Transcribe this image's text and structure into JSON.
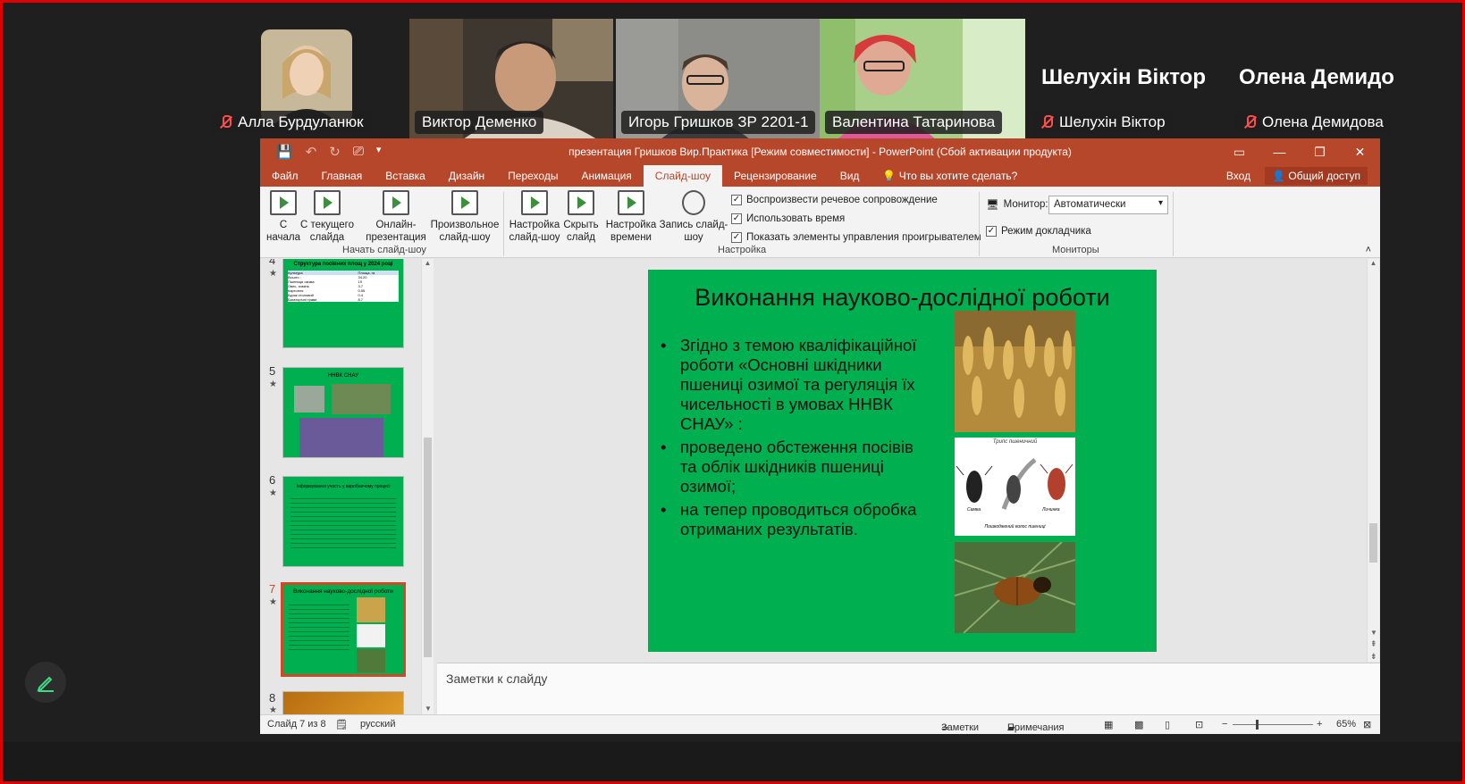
{
  "participants": [
    {
      "name": "Алла Бурдуланюк",
      "muted": true
    },
    {
      "name": "Виктор Деменко",
      "muted": false
    },
    {
      "name": "Игорь Гришков ЗР 2201-1",
      "muted": false,
      "speaking": true
    },
    {
      "name": "Валентина Татаринова",
      "muted": false
    },
    {
      "name": "Шелухін Віктор",
      "muted": true,
      "display_name": "Шелухін Віктор"
    },
    {
      "name": "Олена Демидова",
      "muted": true,
      "display_name": "Олена Демидо"
    }
  ],
  "window": {
    "title": "презентация Гришков Вир.Практика [Режим совместимости] - PowerPoint (Сбой активации продукта)"
  },
  "tabs": [
    "Файл",
    "Главная",
    "Вставка",
    "Дизайн",
    "Переходы",
    "Анимация",
    "Слайд-шоу",
    "Рецензирование",
    "Вид"
  ],
  "tab_selected": "Слайд-шоу",
  "tell_me": "Что вы хотите сделать?",
  "signin": "Вход",
  "share": "Общий доступ",
  "ribbon": {
    "from_start": "С начала",
    "from_current": "С текущего слайда",
    "online": "Онлайн-презентация",
    "custom": "Произвольное слайд-шоу",
    "group_start": "Начать слайд-шоу",
    "setup": "Настройка слайд-шоу",
    "hide": "Скрыть слайд",
    "rehearse": "Настройка времени",
    "record": "Запись слайд-шоу",
    "opt_narration": "Воспроизвести речевое сопровождение",
    "opt_timings": "Использовать время",
    "opt_controls": "Показать элементы управления проигрывателем",
    "group_setup": "Настройка",
    "monitor_label": "Монитор:",
    "monitor_value": "Автоматически",
    "presenter_view": "Режим докладчика",
    "group_monitors": "Мониторы"
  },
  "thumbnails": {
    "slide4_title": "Структура посівних площ у 2024 році",
    "slide4_table": {
      "headers": [
        "Культура",
        "Площа, га"
      ],
      "rows": [
        [
          "Всього :",
          "34.20"
        ],
        [
          "Пшениця озима",
          "19"
        ],
        [
          "Овес, ячмінь",
          "3.7"
        ],
        [
          "Картопля",
          "0.55"
        ],
        [
          "Буряк столовий",
          "0.4"
        ],
        [
          "Багаторічні трави",
          "8.7"
        ]
      ]
    },
    "slide5_title": "ННВК СНАУ",
    "slide6_title": "Інформування участь у виробничому процесі",
    "slide7_title": "Виконання науково-дослідної роботи",
    "numbers": [
      "4",
      "5",
      "6",
      "7",
      "8"
    ]
  },
  "slide": {
    "title": "Виконання науково-дослідної роботи",
    "bullets": [
      "Згідно з темою кваліфікаційної роботи «Основні шкідники пшениці озимої та регуляція їх чисельності в умовах ННВК СНАУ» :",
      "проведено обстеження посівів та  облік шкідників пшениці озимої;",
      "на тепер проводиться обробка отриманих результатів."
    ],
    "image_labels": [
      "Трипс пшеничний",
      "Самка",
      "Личинка",
      "Пошкоджений колос пшениці"
    ]
  },
  "notes_placeholder": "Заметки к слайду",
  "status": {
    "slide_counter": "Слайд 7 из 8",
    "language": "русский",
    "notes": "Заметки",
    "comments": "Примечания",
    "zoom": "65%"
  },
  "colors": {
    "ppt_accent": "#b7472a",
    "slide_bg": "#00b050",
    "speaking_border": "#2ecc71",
    "frame_border": "#e00000"
  }
}
